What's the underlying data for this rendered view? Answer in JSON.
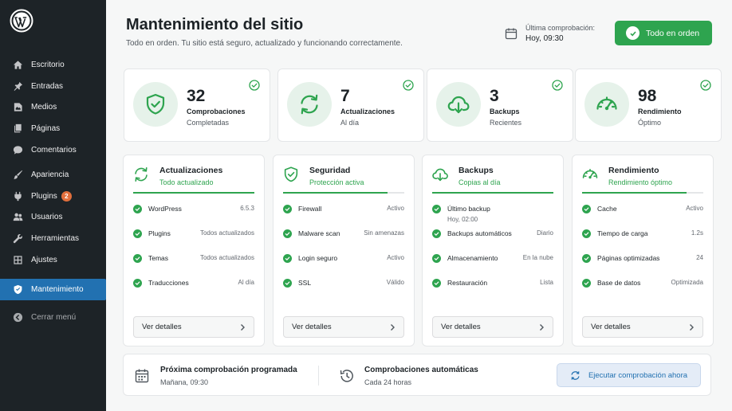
{
  "sidebar": {
    "items": [
      {
        "label": "Escritorio",
        "icon": "home-icon"
      },
      {
        "label": "Entradas",
        "icon": "pin-icon"
      },
      {
        "label": "Medios",
        "icon": "media-icon"
      },
      {
        "label": "Páginas",
        "icon": "pages-icon"
      },
      {
        "label": "Comentarios",
        "icon": "comment-icon"
      },
      {
        "label": "Apariencia",
        "icon": "brush-icon"
      },
      {
        "label": "Plugins",
        "icon": "plugin-icon",
        "badge": "2"
      },
      {
        "label": "Usuarios",
        "icon": "users-icon"
      },
      {
        "label": "Herramientas",
        "icon": "wrench-icon"
      },
      {
        "label": "Ajustes",
        "icon": "settings-icon"
      },
      {
        "label": "Mantenimiento",
        "icon": "shield-icon",
        "active": true
      }
    ],
    "collapse_label": "Cerrar menú"
  },
  "header": {
    "title": "Mantenimiento del sitio",
    "subtitle": "Todo en orden. Tu sitio está seguro, actualizado y funcionando correctamente.",
    "last_check_label": "Última comprobación:",
    "last_check_value": "Hoy, 09:30",
    "status_button": "Todo en orden"
  },
  "stats": [
    {
      "number": "32",
      "label": "Comprobaciones",
      "sub": "Completadas",
      "icon": "shield-check-icon"
    },
    {
      "number": "7",
      "label": "Actualizaciones",
      "sub": "Al día",
      "icon": "refresh-icon"
    },
    {
      "number": "3",
      "label": "Backups",
      "sub": "Recientes",
      "icon": "cloud-download-icon"
    },
    {
      "number": "98",
      "label": "Rendimiento",
      "sub": "Óptimo",
      "icon": "speedometer-icon"
    }
  ],
  "cards": [
    {
      "title": "Actualizaciones",
      "status": "Todo actualizado",
      "icon": "refresh-icon",
      "progress": 1.0,
      "rows": [
        {
          "name": "WordPress",
          "value": "6.5.3"
        },
        {
          "name": "Plugins",
          "value": "Todos actualizados"
        },
        {
          "name": "Temas",
          "value": "Todos actualizados"
        },
        {
          "name": "Traducciones",
          "value": "Al día"
        }
      ],
      "button": "Ver detalles"
    },
    {
      "title": "Seguridad",
      "status": "Protección activa",
      "icon": "shield-check-icon",
      "progress": 0.86,
      "rows": [
        {
          "name": "Firewall",
          "value": "Activo"
        },
        {
          "name": "Malware scan",
          "value": "Sin amenazas"
        },
        {
          "name": "Login seguro",
          "value": "Activo"
        },
        {
          "name": "SSL",
          "value": "Válido"
        }
      ],
      "button": "Ver detalles"
    },
    {
      "title": "Backups",
      "status": "Copias al día",
      "icon": "cloud-download-icon",
      "progress": 1.0,
      "rows": [
        {
          "name": "Último backup",
          "value": "",
          "note": "Hoy, 02:00"
        },
        {
          "name": "Backups automáticos",
          "value": "Diario"
        },
        {
          "name": "Almacenamiento",
          "value": "En la nube"
        },
        {
          "name": "Restauración",
          "value": "Lista"
        }
      ],
      "button": "Ver detalles"
    },
    {
      "title": "Rendimiento",
      "status": "Rendimiento óptimo",
      "icon": "speedometer-icon",
      "progress": 0.86,
      "rows": [
        {
          "name": "Cache",
          "value": "Activo"
        },
        {
          "name": "Tiempo de carga",
          "value": "1.2s"
        },
        {
          "name": "Páginas optimizadas",
          "value": "24"
        },
        {
          "name": "Base de datos",
          "value": "Optimizada"
        }
      ],
      "button": "Ver detalles"
    }
  ],
  "bottom": {
    "next_title": "Próxima comprobación programada",
    "next_value": "Mañana, 09:30",
    "auto_title": "Comprobaciones automáticas",
    "auto_value": "Cada 24 horas",
    "run_button": "Ejecutar comprobación ahora"
  },
  "colors": {
    "accent": "#2ea44f",
    "active": "#2271b1",
    "sidebar": "#1d2327",
    "badge": "#e26f3c"
  }
}
